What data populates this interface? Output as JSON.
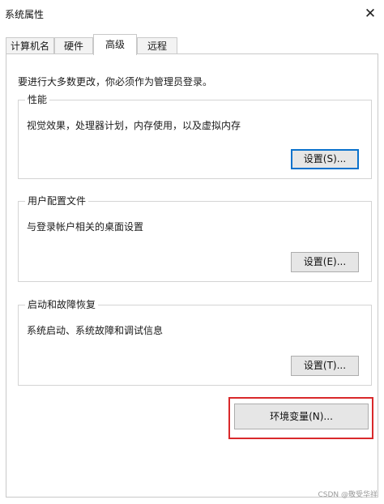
{
  "window": {
    "title": "系统属性",
    "close_glyph": "✕"
  },
  "tabs": [
    {
      "label": "计算机名"
    },
    {
      "label": "硬件"
    },
    {
      "label": "高级",
      "active": true
    },
    {
      "label": "远程"
    }
  ],
  "advanced": {
    "admin_note": "要进行大多数更改，你必须作为管理员登录。",
    "performance": {
      "title": "性能",
      "description": "视觉效果，处理器计划，内存使用，以及虚拟内存",
      "button": "设置(S)..."
    },
    "user_profiles": {
      "title": "用户配置文件",
      "description": "与登录帐户相关的桌面设置",
      "button": "设置(E)..."
    },
    "startup_recovery": {
      "title": "启动和故障恢复",
      "description": "系统启动、系统故障和调试信息",
      "button": "设置(T)..."
    },
    "env_button": "环境变量(N)..."
  },
  "highlight_color": "#d9292b",
  "focus_color": "#0a72cc",
  "watermark": "CSDN @敬受华祥"
}
